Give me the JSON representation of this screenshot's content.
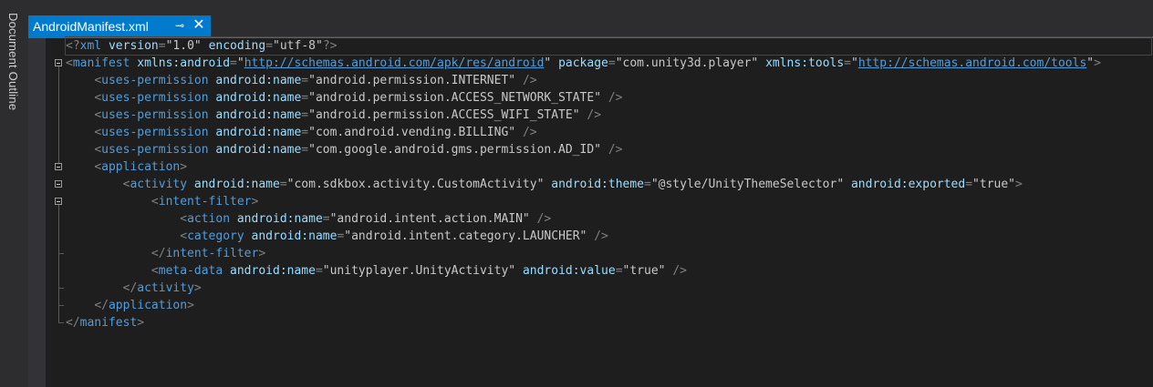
{
  "side_panel": {
    "label": "Document Outline"
  },
  "tab": {
    "title": "AndroidManifest.xml",
    "pin_glyph": "⊸",
    "close_glyph": "✕"
  },
  "colors": {
    "accent": "#007acc",
    "editor_bg": "#1e1e1e",
    "tag": "#569cd6",
    "attribute": "#9cdcfe",
    "value": "#c8c8c8",
    "delimiter": "#808080"
  },
  "code_lines": [
    [
      [
        "d",
        "<?"
      ],
      [
        "t",
        "xml"
      ],
      [
        "v",
        " "
      ],
      [
        "a",
        "version"
      ],
      [
        "d",
        "="
      ],
      [
        "v",
        "\"1.0\""
      ],
      [
        "v",
        " "
      ],
      [
        "a",
        "encoding"
      ],
      [
        "d",
        "="
      ],
      [
        "v",
        "\"utf-8\""
      ],
      [
        "d",
        "?>"
      ]
    ],
    [
      [
        "d",
        "<"
      ],
      [
        "t",
        "manifest"
      ],
      [
        "v",
        " "
      ],
      [
        "a",
        "xmlns:android"
      ],
      [
        "d",
        "="
      ],
      [
        "v",
        "\""
      ],
      [
        "u",
        "http://schemas.android.com/apk/res/android"
      ],
      [
        "v",
        "\""
      ],
      [
        "v",
        " "
      ],
      [
        "a",
        "package"
      ],
      [
        "d",
        "="
      ],
      [
        "v",
        "\"com.unity3d.player\""
      ],
      [
        "v",
        " "
      ],
      [
        "a",
        "xmlns:tools"
      ],
      [
        "d",
        "="
      ],
      [
        "v",
        "\""
      ],
      [
        "u",
        "http://schemas.android.com/tools"
      ],
      [
        "v",
        "\""
      ],
      [
        "d",
        ">"
      ]
    ],
    [
      [
        "v",
        "    "
      ],
      [
        "d",
        "<"
      ],
      [
        "t",
        "uses-permission"
      ],
      [
        "v",
        " "
      ],
      [
        "a",
        "android:name"
      ],
      [
        "d",
        "="
      ],
      [
        "v",
        "\"android.permission.INTERNET\""
      ],
      [
        "v",
        " "
      ],
      [
        "d",
        "/>"
      ]
    ],
    [
      [
        "v",
        "    "
      ],
      [
        "d",
        "<"
      ],
      [
        "t",
        "uses-permission"
      ],
      [
        "v",
        " "
      ],
      [
        "a",
        "android:name"
      ],
      [
        "d",
        "="
      ],
      [
        "v",
        "\"android.permission.ACCESS_NETWORK_STATE\""
      ],
      [
        "v",
        " "
      ],
      [
        "d",
        "/>"
      ]
    ],
    [
      [
        "v",
        "    "
      ],
      [
        "d",
        "<"
      ],
      [
        "t",
        "uses-permission"
      ],
      [
        "v",
        " "
      ],
      [
        "a",
        "android:name"
      ],
      [
        "d",
        "="
      ],
      [
        "v",
        "\"android.permission.ACCESS_WIFI_STATE\""
      ],
      [
        "v",
        " "
      ],
      [
        "d",
        "/>"
      ]
    ],
    [
      [
        "v",
        "    "
      ],
      [
        "d",
        "<"
      ],
      [
        "t",
        "uses-permission"
      ],
      [
        "v",
        " "
      ],
      [
        "a",
        "android:name"
      ],
      [
        "d",
        "="
      ],
      [
        "v",
        "\"com.android.vending.BILLING\""
      ],
      [
        "v",
        " "
      ],
      [
        "d",
        "/>"
      ]
    ],
    [
      [
        "v",
        "    "
      ],
      [
        "d",
        "<"
      ],
      [
        "t",
        "uses-permission"
      ],
      [
        "v",
        " "
      ],
      [
        "a",
        "android:name"
      ],
      [
        "d",
        "="
      ],
      [
        "v",
        "\"com.google.android.gms.permission.AD_ID\""
      ],
      [
        "v",
        " "
      ],
      [
        "d",
        "/>"
      ]
    ],
    [
      [
        "v",
        "    "
      ],
      [
        "d",
        "<"
      ],
      [
        "t",
        "application"
      ],
      [
        "d",
        ">"
      ]
    ],
    [
      [
        "v",
        "        "
      ],
      [
        "d",
        "<"
      ],
      [
        "t",
        "activity"
      ],
      [
        "v",
        " "
      ],
      [
        "a",
        "android:name"
      ],
      [
        "d",
        "="
      ],
      [
        "v",
        "\"com.sdkbox.activity.CustomActivity\""
      ],
      [
        "v",
        " "
      ],
      [
        "a",
        "android:theme"
      ],
      [
        "d",
        "="
      ],
      [
        "v",
        "\"@style/UnityThemeSelector\""
      ],
      [
        "v",
        " "
      ],
      [
        "a",
        "android:exported"
      ],
      [
        "d",
        "="
      ],
      [
        "v",
        "\"true\""
      ],
      [
        "d",
        ">"
      ]
    ],
    [
      [
        "v",
        "            "
      ],
      [
        "d",
        "<"
      ],
      [
        "t",
        "intent-filter"
      ],
      [
        "d",
        ">"
      ]
    ],
    [
      [
        "v",
        "                "
      ],
      [
        "d",
        "<"
      ],
      [
        "t",
        "action"
      ],
      [
        "v",
        " "
      ],
      [
        "a",
        "android:name"
      ],
      [
        "d",
        "="
      ],
      [
        "v",
        "\"android.intent.action.MAIN\""
      ],
      [
        "v",
        " "
      ],
      [
        "d",
        "/>"
      ]
    ],
    [
      [
        "v",
        "                "
      ],
      [
        "d",
        "<"
      ],
      [
        "t",
        "category"
      ],
      [
        "v",
        " "
      ],
      [
        "a",
        "android:name"
      ],
      [
        "d",
        "="
      ],
      [
        "v",
        "\"android.intent.category.LAUNCHER\""
      ],
      [
        "v",
        " "
      ],
      [
        "d",
        "/>"
      ]
    ],
    [
      [
        "v",
        "            "
      ],
      [
        "d",
        "</"
      ],
      [
        "t",
        "intent-filter"
      ],
      [
        "d",
        ">"
      ]
    ],
    [
      [
        "v",
        "            "
      ],
      [
        "d",
        "<"
      ],
      [
        "t",
        "meta-data"
      ],
      [
        "v",
        " "
      ],
      [
        "a",
        "android:name"
      ],
      [
        "d",
        "="
      ],
      [
        "v",
        "\"unityplayer.UnityActivity\""
      ],
      [
        "v",
        " "
      ],
      [
        "a",
        "android:value"
      ],
      [
        "d",
        "="
      ],
      [
        "v",
        "\"true\""
      ],
      [
        "v",
        " "
      ],
      [
        "d",
        "/>"
      ]
    ],
    [
      [
        "v",
        "        "
      ],
      [
        "d",
        "</"
      ],
      [
        "t",
        "activity"
      ],
      [
        "d",
        ">"
      ]
    ],
    [
      [
        "v",
        "    "
      ],
      [
        "d",
        "</"
      ],
      [
        "t",
        "application"
      ],
      [
        "d",
        ">"
      ]
    ],
    [
      [
        "d",
        "</"
      ],
      [
        "t",
        "manifest"
      ],
      [
        "d",
        ">"
      ]
    ]
  ]
}
